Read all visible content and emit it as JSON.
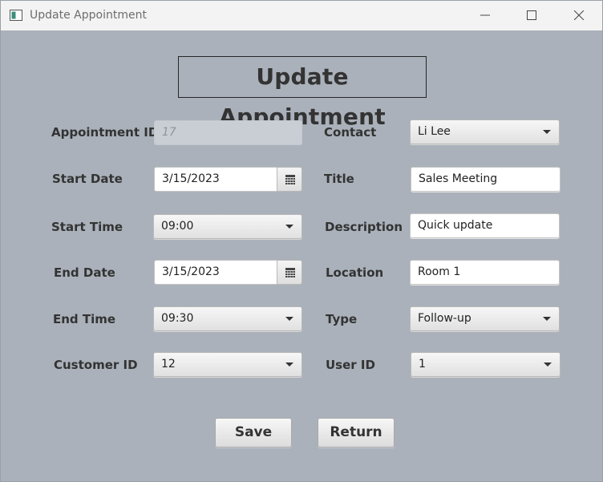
{
  "window": {
    "title": "Update Appointment"
  },
  "heading": "Update Appointment",
  "left_fields": {
    "appointment_id": {
      "label": "Appointment ID",
      "value": "17"
    },
    "start_date": {
      "label": "Start Date",
      "value": "3/15/2023"
    },
    "start_time": {
      "label": "Start Time",
      "value": "09:00"
    },
    "end_date": {
      "label": "End Date",
      "value": "3/15/2023"
    },
    "end_time": {
      "label": "End Time",
      "value": "09:30"
    },
    "customer_id": {
      "label": "Customer ID",
      "value": "12"
    }
  },
  "right_fields": {
    "contact": {
      "label": "Contact",
      "value": "Li Lee"
    },
    "title": {
      "label": "Title",
      "value": "Sales Meeting"
    },
    "description": {
      "label": "Description",
      "value": "Quick update"
    },
    "location": {
      "label": "Location",
      "value": "Room 1"
    },
    "type": {
      "label": "Type",
      "value": "Follow-up"
    },
    "user_id": {
      "label": "User ID",
      "value": "1"
    }
  },
  "buttons": {
    "save": "Save",
    "return": "Return"
  },
  "colors": {
    "background": "#aab1ba",
    "titlebar": "#f3f3f3",
    "text": "#333333"
  },
  "icons": [
    "app-icon",
    "minimize-icon",
    "maximize-icon",
    "close-icon",
    "calendar-icon",
    "chevron-down-icon"
  ]
}
